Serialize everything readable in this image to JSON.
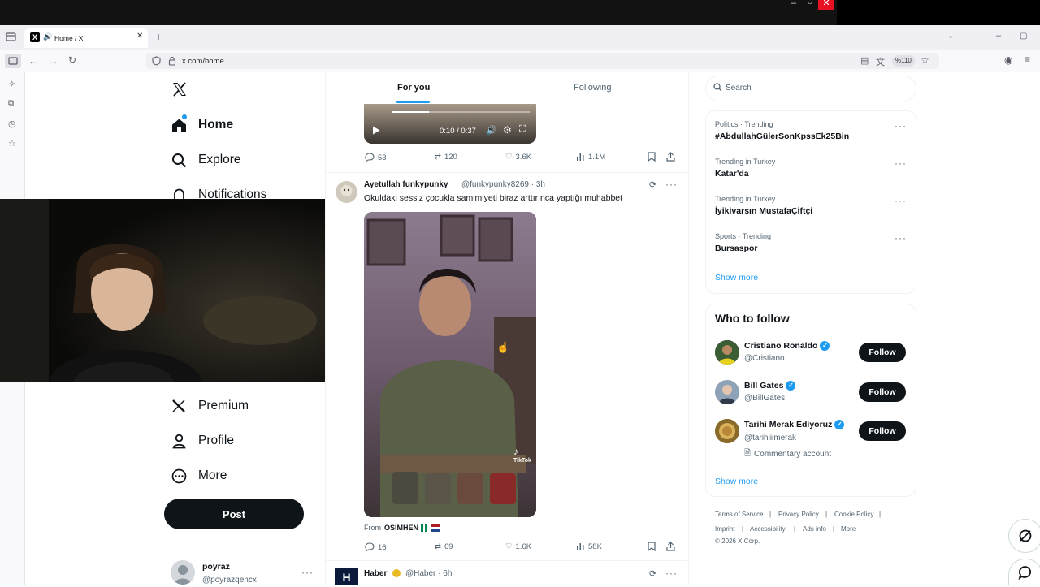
{
  "browser": {
    "tab_title": "Home / X",
    "url": "x.com/home",
    "zoom": "%110",
    "new_tab": "+"
  },
  "sidebar": {
    "items": [
      {
        "label": "Home",
        "icon": "home-icon"
      },
      {
        "label": "Explore",
        "icon": "search-icon"
      },
      {
        "label": "Notifications",
        "icon": "bell-icon"
      },
      {
        "label": "Premium",
        "icon": "x-logo-icon"
      },
      {
        "label": "Profile",
        "icon": "person-icon"
      },
      {
        "label": "More",
        "icon": "more-circle-icon"
      }
    ],
    "post_label": "Post",
    "account": {
      "name": "poyraz",
      "handle": "@poyrazqencx",
      "more": "···"
    }
  },
  "feed": {
    "tabs": [
      {
        "label": "For you"
      },
      {
        "label": "Following"
      }
    ],
    "video": {
      "time": "0:10 / 0:37"
    },
    "tweets": [
      {
        "stats": {
          "replies": "53",
          "reposts": "120",
          "likes": "3.6K",
          "views": "1.1M"
        }
      },
      {
        "name": "Ayetullah funkypunky",
        "handle": "@funkypunky8269 · 3h",
        "text": "Okuldaki sessiz çocukla samimiyeti biraz arttırınca yaptığı muhabbet",
        "from_label": "From",
        "from_name": "OSIMHEN",
        "media_watermark": "TikTok",
        "stats": {
          "replies": "16",
          "reposts": "69",
          "likes": "1.6K",
          "views": "58K"
        }
      },
      {
        "name": "Haber",
        "handle": "@Haber · 6h",
        "avatar_letter": "H"
      }
    ]
  },
  "right": {
    "search_placeholder": "Search",
    "trends": [
      {
        "category": "Politics · Trending",
        "name": "#AbdullahGülerSonKpssEk25Bin"
      },
      {
        "category": "Trending in Turkey",
        "name": "Katar'da"
      },
      {
        "category": "Trending in Turkey",
        "name": "İyikivarsın MustafaÇiftçi"
      },
      {
        "category": "Sports · Trending",
        "name": "Bursaspor"
      }
    ],
    "trends_show_more": "Show more",
    "who_to_follow": {
      "title": "Who to follow",
      "accounts": [
        {
          "name": "Cristiano Ronaldo",
          "handle": "@Cristiano",
          "button": "Follow"
        },
        {
          "name": "Bill Gates",
          "handle": "@BillGates",
          "button": "Follow"
        },
        {
          "name": "Tarihi Merak Ediyoruz",
          "handle": "@tarihiiimerak",
          "note": "Commentary account",
          "button": "Follow"
        }
      ],
      "show_more": "Show more"
    },
    "footer": {
      "links": [
        "Terms of Service",
        "Privacy Policy",
        "Cookie Policy",
        "Imprint",
        "Accessibility",
        "Ads info",
        "More ···"
      ],
      "copyright": "© 2026 X Corp."
    }
  },
  "colors": {
    "accent": "#1d9bf0",
    "text": "#0f1419",
    "muted": "#536471",
    "close_red": "#e81123"
  }
}
